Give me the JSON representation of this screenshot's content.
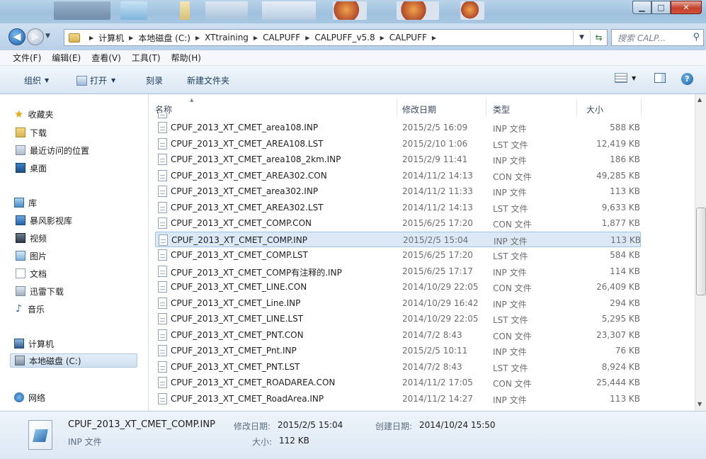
{
  "address": {
    "breadcrumbs": [
      "计算机",
      "本地磁盘 (C:)",
      "XTtraining",
      "CALPUFF",
      "CALPUFF_v5.8",
      "CALPUFF"
    ],
    "search_placeholder": "搜索 CALP..."
  },
  "menu": [
    "文件(F)",
    "编辑(E)",
    "查看(V)",
    "工具(T)",
    "帮助(H)"
  ],
  "commands": {
    "organize": "组织",
    "open": "打开",
    "burn": "刻录",
    "new_folder": "新建文件夹"
  },
  "sidebar": {
    "favorites": "收藏夹",
    "downloads": "下载",
    "recent": "最近访问的位置",
    "desktop": "桌面",
    "libraries": "库",
    "storm": "暴风影视库",
    "videos": "视频",
    "pictures": "图片",
    "documents": "文档",
    "xunlei": "迅雷下载",
    "music": "音乐",
    "computer": "计算机",
    "local_disk": "本地磁盘 (C:)",
    "network": "网络"
  },
  "columns": {
    "name": "名称",
    "date": "修改日期",
    "type": "类型",
    "size": "大小"
  },
  "files": [
    {
      "name": "CPUF_2013_XT_CMET_area108.INP",
      "date": "2015/2/5 16:09",
      "type": "INP 文件",
      "size": "588 KB"
    },
    {
      "name": "CPUF_2013_XT_CMET_AREA108.LST",
      "date": "2015/2/10 1:06",
      "type": "LST 文件",
      "size": "12,419 KB"
    },
    {
      "name": "CPUF_2013_XT_CMET_area108_2km.INP",
      "date": "2015/2/9 11:41",
      "type": "INP 文件",
      "size": "186 KB"
    },
    {
      "name": "CPUF_2013_XT_CMET_AREA302.CON",
      "date": "2014/11/2 14:13",
      "type": "CON 文件",
      "size": "49,285 KB"
    },
    {
      "name": "CPUF_2013_XT_CMET_area302.INP",
      "date": "2014/11/2 11:33",
      "type": "INP 文件",
      "size": "113 KB"
    },
    {
      "name": "CPUF_2013_XT_CMET_AREA302.LST",
      "date": "2014/11/2 14:13",
      "type": "LST 文件",
      "size": "9,633 KB"
    },
    {
      "name": "CPUF_2013_XT_CMET_COMP.CON",
      "date": "2015/6/25 17:20",
      "type": "CON 文件",
      "size": "1,877 KB"
    },
    {
      "name": "CPUF_2013_XT_CMET_COMP.INP",
      "date": "2015/2/5 15:04",
      "type": "INP 文件",
      "size": "113 KB"
    },
    {
      "name": "CPUF_2013_XT_CMET_COMP.LST",
      "date": "2015/6/25 17:20",
      "type": "LST 文件",
      "size": "584 KB"
    },
    {
      "name": "CPUF_2013_XT_CMET_COMP有注释的.INP",
      "date": "2015/6/25 17:17",
      "type": "INP 文件",
      "size": "114 KB"
    },
    {
      "name": "CPUF_2013_XT_CMET_LINE.CON",
      "date": "2014/10/29 22:05",
      "type": "CON 文件",
      "size": "26,409 KB"
    },
    {
      "name": "CPUF_2013_XT_CMET_Line.INP",
      "date": "2014/10/29 16:42",
      "type": "INP 文件",
      "size": "294 KB"
    },
    {
      "name": "CPUF_2013_XT_CMET_LINE.LST",
      "date": "2014/10/29 22:05",
      "type": "LST 文件",
      "size": "5,295 KB"
    },
    {
      "name": "CPUF_2013_XT_CMET_PNT.CON",
      "date": "2014/7/2 8:43",
      "type": "CON 文件",
      "size": "23,307 KB"
    },
    {
      "name": "CPUF_2013_XT_CMET_Pnt.INP",
      "date": "2015/2/5 10:11",
      "type": "INP 文件",
      "size": "76 KB"
    },
    {
      "name": "CPUF_2013_XT_CMET_PNT.LST",
      "date": "2014/7/2 8:43",
      "type": "LST 文件",
      "size": "8,924 KB"
    },
    {
      "name": "CPUF_2013_XT_CMET_ROADAREA.CON",
      "date": "2014/11/2 17:05",
      "type": "CON 文件",
      "size": "25,444 KB"
    },
    {
      "name": "CPUF_2013_XT_CMET_RoadArea.INP",
      "date": "2014/11/2 14:27",
      "type": "INP 文件",
      "size": "113 KB"
    }
  ],
  "details": {
    "filename": "CPUF_2013_XT_CMET_COMP.INP",
    "modified_label": "修改日期:",
    "modified": "2015/2/5 15:04",
    "created_label": "创建日期:",
    "created": "2014/10/24 15:50",
    "type": "INP 文件",
    "size_label": "大小:",
    "size": "112 KB"
  }
}
